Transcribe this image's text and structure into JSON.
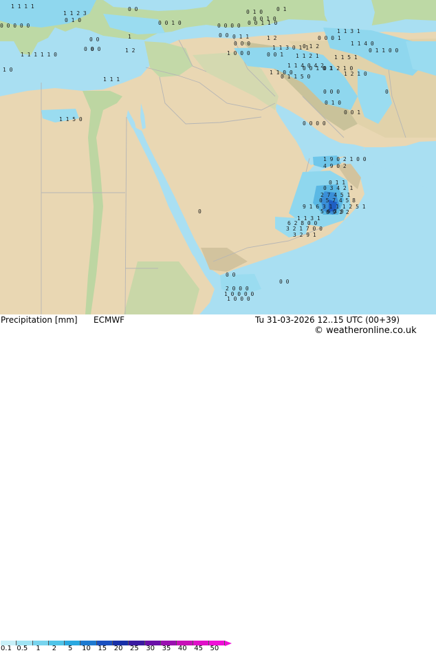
{
  "title": "Precipitation [mm]",
  "model": "ECMWF",
  "valid_time": "Tu 31-03-2026 12..15 UTC (00+39)",
  "credit": "© weatheronline.co.uk",
  "legend": {
    "labels": [
      "0.1",
      "0.5",
      "1",
      "2",
      "5",
      "10",
      "15",
      "20",
      "25",
      "30",
      "35",
      "40",
      "45",
      "50"
    ],
    "colors": [
      "#c8f0f8",
      "#a0e4f4",
      "#78d4ee",
      "#50c4e8",
      "#2aa8e0",
      "#1e7ad0",
      "#1a50c0",
      "#1830a8",
      "#3a1aa0",
      "#6a10a8",
      "#9a10b0",
      "#c810b8",
      "#e010c8",
      "#f010d8"
    ]
  },
  "colors": {
    "sea": "#a9dff2",
    "desert": "#ead9b6",
    "green": "#bcd8a4",
    "mountain": "#d9c9a6",
    "border": "#b0b0b0"
  },
  "map_numbers": [
    "1 1 1 1",
    "1 1 2 3",
    "0 0 0 0 0",
    "0 1 0",
    "1 1 1 1 1 0",
    "1 0",
    "0 0",
    "1",
    "0 0",
    "1 2",
    "1 1 5 0",
    "0 0",
    "1 1 1",
    "0 0",
    "0 0 1 0",
    "0 0 0 0",
    "0 0",
    "0 1",
    "1 2",
    "0 1 0",
    "0 0 1 0",
    "0 0 1 1 0",
    "0 1 1",
    "0 0 0",
    "1 1 3 0 1 1",
    "0 1 2",
    "1 0 0 0",
    "0 0 1",
    "1 1 2 1",
    "0 0 0 1",
    "1 1 3 1",
    "1 1 4 0 4 2",
    "0 0 1 0 1",
    "0 1 2 1 0",
    "1 2 1 0",
    "1 1 0 0",
    "0 1 1 5 0",
    "1 1 5 1",
    "0 1 1 0 0",
    "1 1 4 0",
    "0 0 0",
    "0 1 0",
    "0 0 1",
    "0 0 0 0",
    "1 9 0 2 1 0 0",
    "4 9 0 2",
    "0 1 1",
    "0 3 4 2 1",
    "2 7 4 5 1",
    "0 5 7 4 5 8",
    "9 1 6 3 1 1 1 2 5 1",
    "0 9 2 2",
    "5 6 3 0",
    "1 1 3 1",
    "6 2 8 0 0",
    "3 2 1 7 0 0",
    "3 2 9 1",
    "0",
    "0 0",
    "2 0 0 0",
    "1 0 0 0 0",
    "1 0 0 0",
    "0 0",
    "0"
  ]
}
